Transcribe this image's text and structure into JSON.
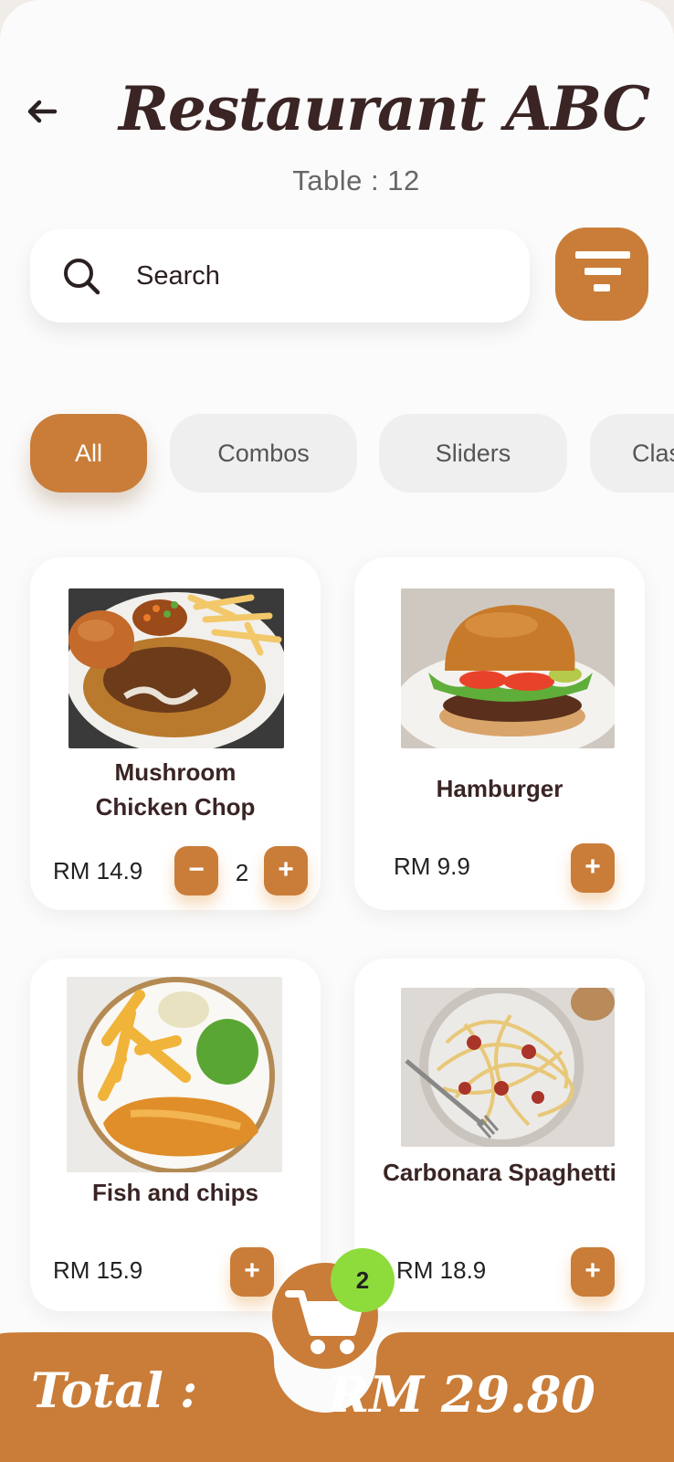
{
  "header": {
    "title": "Restaurant ABC",
    "table": "Table : 12"
  },
  "search": {
    "placeholder": "Search"
  },
  "categories": [
    "All",
    "Combos",
    "Sliders",
    "Clas"
  ],
  "menu": [
    {
      "name_line1": "Mushroom",
      "name_line2": "Chicken Chop",
      "price": "RM 14.9",
      "qty": "2",
      "minus": "−",
      "plus": "+"
    },
    {
      "name": "Hamburger",
      "price": "RM 9.9",
      "plus": "+"
    },
    {
      "name": "Fish and chips",
      "price": "RM 15.9",
      "plus": "+"
    },
    {
      "name": "Carbonara Spaghetti",
      "price": "RM 18.9",
      "plus": "+"
    }
  ],
  "cart": {
    "count": "2",
    "total_label": "Total :",
    "total_value": "RM 29.80"
  },
  "colors": {
    "accent": "#c97d39",
    "badge": "#8edb3c"
  }
}
